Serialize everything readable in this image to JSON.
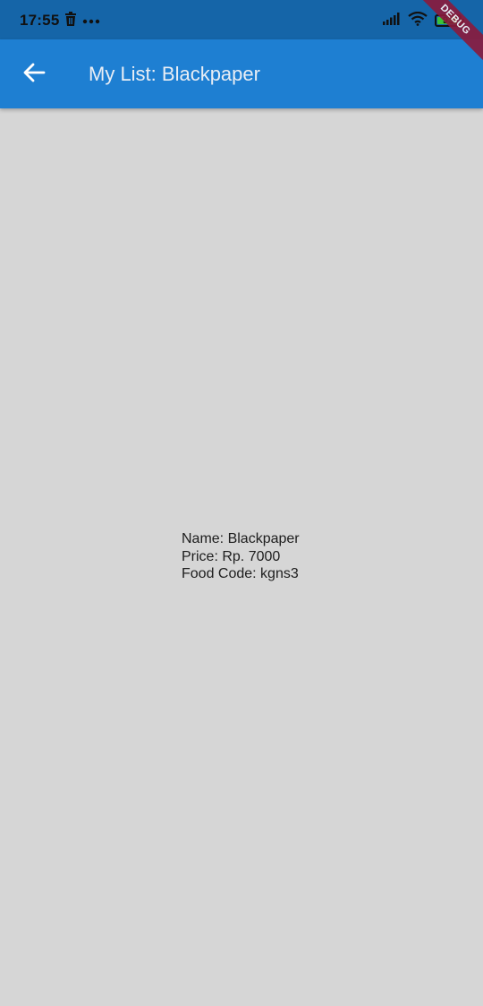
{
  "status_bar": {
    "time": "17:55",
    "battery_level": "93",
    "icons": [
      "trash-icon",
      "more-dots-icon",
      "signal-icon",
      "wifi-icon",
      "battery-icon"
    ],
    "color": "#1565a8"
  },
  "debug_banner": "DEBUG",
  "app_bar": {
    "title": "My List: Blackpaper",
    "back_icon": "arrow-back-icon",
    "color": "#1e7fd2"
  },
  "item": {
    "name_line": "Name: Blackpaper",
    "price_line": "Price: Rp. 7000",
    "code_line": "Food Code: kgns3"
  },
  "background_color": "#d6d6d6"
}
